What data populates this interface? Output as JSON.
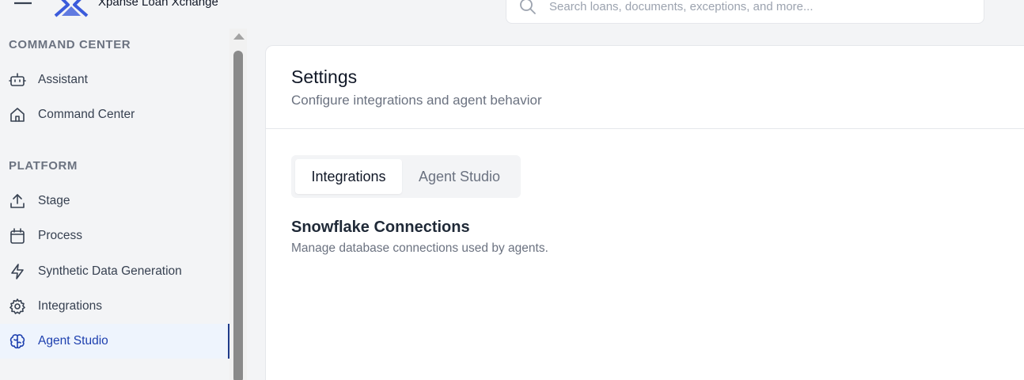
{
  "app": {
    "title": "Xpanse Loan Xchange"
  },
  "search": {
    "placeholder": "Search loans, documents, exceptions, and more...",
    "value": ""
  },
  "sidebar": {
    "sections": [
      {
        "title": "COMMAND CENTER",
        "items": [
          {
            "label": "Assistant",
            "icon": "robot-icon"
          },
          {
            "label": "Command Center",
            "icon": "home-icon"
          }
        ]
      },
      {
        "title": "PLATFORM",
        "items": [
          {
            "label": "Stage",
            "icon": "upload-icon"
          },
          {
            "label": "Process",
            "icon": "calendar-icon"
          },
          {
            "label": "Synthetic Data Generation",
            "icon": "lightning-icon"
          },
          {
            "label": "Integrations",
            "icon": "gear-icon"
          },
          {
            "label": "Agent Studio",
            "icon": "brain-icon",
            "active": true
          }
        ]
      }
    ]
  },
  "main": {
    "title": "Settings",
    "subtitle": "Configure integrations and agent behavior",
    "tabs": [
      {
        "label": "Integrations",
        "active": true
      },
      {
        "label": "Agent Studio",
        "active": false
      }
    ],
    "section": {
      "heading": "Snowflake Connections",
      "description": "Manage database connections used by agents."
    }
  },
  "colors": {
    "accent": "#1e40af",
    "active_bg": "#eef4fd",
    "page_bg": "#f3f4f6",
    "logo": "#3b5bdb"
  }
}
